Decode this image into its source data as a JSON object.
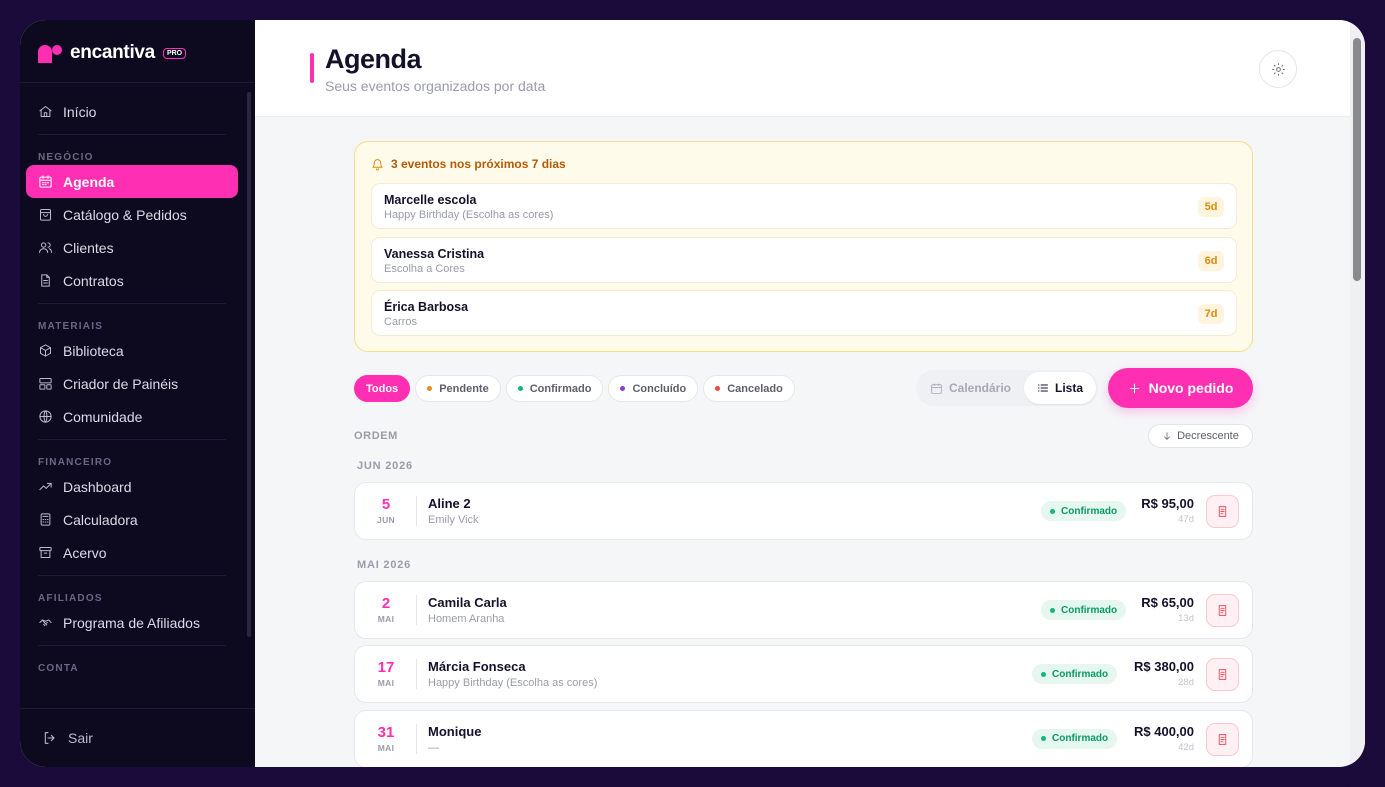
{
  "brand": {
    "name": "encantiva",
    "badge": "PRO"
  },
  "sidebar": {
    "items": [
      {
        "label": "Início",
        "icon": "home-icon"
      },
      {
        "section": "NEGÓCIO"
      },
      {
        "label": "Agenda",
        "icon": "calendar-icon",
        "active": true
      },
      {
        "label": "Catálogo & Pedidos",
        "icon": "bag-icon"
      },
      {
        "label": "Clientes",
        "icon": "users-icon"
      },
      {
        "label": "Contratos",
        "icon": "file-icon"
      },
      {
        "section": "MATERIAIS"
      },
      {
        "label": "Biblioteca",
        "icon": "box-icon"
      },
      {
        "label": "Criador de Painéis",
        "icon": "layout-icon"
      },
      {
        "label": "Comunidade",
        "icon": "globe-icon"
      },
      {
        "section": "FINANCEIRO"
      },
      {
        "label": "Dashboard",
        "icon": "trend-icon"
      },
      {
        "label": "Calculadora",
        "icon": "calculator-icon"
      },
      {
        "label": "Acervo",
        "icon": "archive-icon"
      },
      {
        "section": "AFILIADOS"
      },
      {
        "label": "Programa de Afiliados",
        "icon": "handshake-icon"
      },
      {
        "section": "CONTA"
      }
    ],
    "logout": "Sair"
  },
  "header": {
    "title": "Agenda",
    "subtitle": "Seus eventos organizados por data"
  },
  "upcoming": {
    "title": "3 eventos nos próximos 7 dias",
    "items": [
      {
        "name": "Marcelle escola",
        "product": "Happy Birthday (Escolha as cores)",
        "days": "5d"
      },
      {
        "name": "Vanessa Cristina",
        "product": "Escolha a Cores",
        "days": "6d"
      },
      {
        "name": "Érica Barbosa",
        "product": "Carros",
        "days": "7d"
      }
    ]
  },
  "filters": [
    {
      "label": "Todos",
      "active": true
    },
    {
      "label": "Pendente",
      "color": "#f08a1a"
    },
    {
      "label": "Confirmado",
      "color": "#12b57a"
    },
    {
      "label": "Concluído",
      "color": "#8b3bd9"
    },
    {
      "label": "Cancelado",
      "color": "#ef4a4a"
    }
  ],
  "view": {
    "calendar": "Calendário",
    "list": "Lista"
  },
  "new_order": "Novo pedido",
  "sort": {
    "label": "ORDEM",
    "value": "Decrescente"
  },
  "months": [
    {
      "label": "JUN 2026",
      "orders": [
        {
          "day": "5",
          "month": "JUN",
          "name": "Aline 2",
          "product": "Emily Vick",
          "status": "Confirmado",
          "price": "R$ 95,00",
          "ago": "47d"
        }
      ]
    },
    {
      "label": "MAI 2026",
      "orders": [
        {
          "day": "2",
          "month": "MAI",
          "name": "Camila Carla",
          "product": "Homem Aranha",
          "status": "Confirmado",
          "price": "R$ 65,00",
          "ago": "13d"
        },
        {
          "day": "17",
          "month": "MAI",
          "name": "Márcia Fonseca",
          "product": "Happy Birthday (Escolha as cores)",
          "status": "Confirmado",
          "price": "R$ 380,00",
          "ago": "28d"
        },
        {
          "day": "31",
          "month": "MAI",
          "name": "Monique",
          "product": "—",
          "status": "Confirmado",
          "price": "R$ 400,00",
          "ago": "42d"
        }
      ]
    }
  ],
  "colors": {
    "accent": "#ff2fb3",
    "sidebar": "#0d0a1f",
    "confirmed": "#12b57a"
  }
}
